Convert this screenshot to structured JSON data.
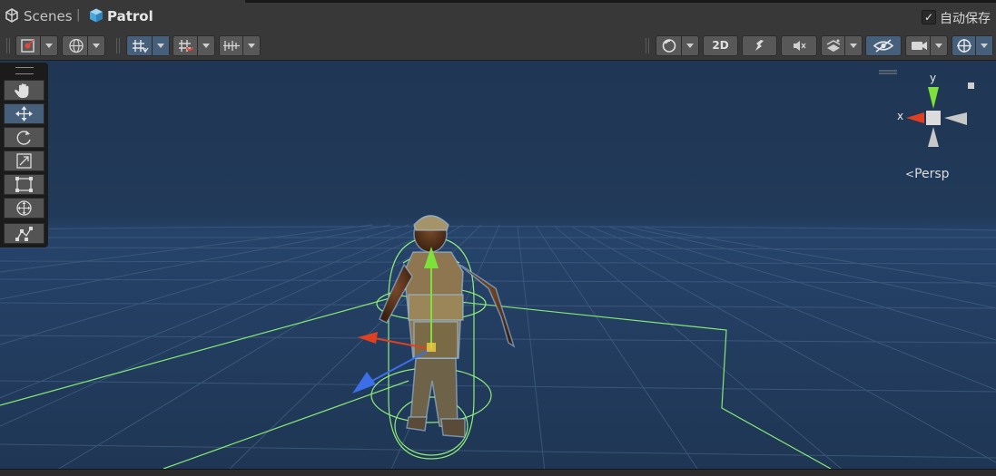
{
  "breadcrumb": {
    "root_label": "Scenes",
    "separator": "|",
    "scene_label": "Patrol"
  },
  "autosave": {
    "label": "自动保存",
    "checked": true
  },
  "toolbar": {
    "left_buttons": [
      {
        "name": "draw-mode-button",
        "icon": "pivot-icon",
        "dropdown": true
      },
      {
        "name": "global-local-button",
        "icon": "globe-icon",
        "dropdown": true
      },
      {
        "name": "grid-snap-button",
        "icon": "grid-snap-icon",
        "dropdown": true,
        "active": true
      },
      {
        "name": "increment-snap-button",
        "icon": "snap-increment-icon",
        "dropdown": true
      },
      {
        "name": "align-button",
        "icon": "align-icon",
        "dropdown": true
      }
    ],
    "right_buttons": [
      {
        "name": "shading-mode-button",
        "icon": "sphere-icon",
        "dropdown": true
      },
      {
        "name": "2d-toggle-button",
        "label": "2D"
      },
      {
        "name": "lighting-toggle-button",
        "icon": "lightbulb-icon"
      },
      {
        "name": "audio-toggle-button",
        "icon": "speaker-mute-icon"
      },
      {
        "name": "effects-button",
        "icon": "effects-icon",
        "dropdown": true
      },
      {
        "name": "scene-visibility-button",
        "icon": "eye-hidden-icon",
        "active": true
      },
      {
        "name": "camera-settings-button",
        "icon": "camera-icon",
        "dropdown": true
      },
      {
        "name": "gizmos-button",
        "icon": "gizmo-icon",
        "dropdown": true
      }
    ],
    "twod_label": "2D"
  },
  "tools": [
    {
      "name": "hand-tool",
      "icon": "hand-icon",
      "active": false
    },
    {
      "name": "move-tool",
      "icon": "move-icon",
      "active": true
    },
    {
      "name": "rotate-tool",
      "icon": "rotate-icon",
      "active": false
    },
    {
      "name": "scale-tool",
      "icon": "scale-icon",
      "active": false
    },
    {
      "name": "rect-tool",
      "icon": "rect-icon",
      "active": false
    },
    {
      "name": "transform-tool",
      "icon": "transform-icon",
      "active": false
    },
    {
      "name": "custom-tool",
      "icon": "custom-editor-icon",
      "active": false
    }
  ],
  "orientation_gizmo": {
    "x_label": "x",
    "y_label": "y",
    "projection_label": "Persp"
  },
  "colors": {
    "scene_background": "#1f3654",
    "grid_line": "#3e5b7d",
    "selection_outline": "#90ee78",
    "axis_x": "#e0401f",
    "axis_y": "#7ee03a",
    "axis_z": "#3a6fe8",
    "toolbar_active": "#46607c"
  },
  "scene": {
    "selected_object": "soldier-character"
  }
}
